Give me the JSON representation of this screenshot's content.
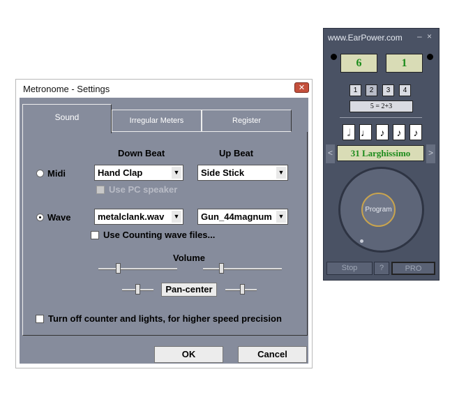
{
  "settings_dialog": {
    "title": "Metronome - Settings",
    "close_glyph": "✕",
    "tabs": [
      "Sound",
      "Irregular Meters",
      "Register"
    ],
    "columns": {
      "down_beat": "Down Beat",
      "up_beat": "Up Beat"
    },
    "midi": {
      "label": "Midi",
      "down_beat_value": "Hand Clap",
      "up_beat_value": "Side Stick",
      "pc_speaker_label": "Use PC speaker"
    },
    "wave": {
      "label": "Wave",
      "down_beat_value": "metalclank.wav",
      "up_beat_value": "Gun_44magnum",
      "counting_label": "Use Counting wave files..."
    },
    "volume_label": "Volume",
    "pan_center_label": "Pan-center",
    "turn_off_label": "Turn off counter and lights, for higher speed precision",
    "ok_label": "OK",
    "cancel_label": "Cancel"
  },
  "earpower": {
    "title": "www.EarPower.com",
    "window_controls": "– ×",
    "beats": "6",
    "count": "1",
    "group_buttons": [
      "1",
      "2",
      "3",
      "4"
    ],
    "grouping": "5 = 2+3",
    "note_values": [
      "𝅗𝅥",
      "♩",
      "♪",
      "♪",
      "♪"
    ],
    "tempo_prev": "<",
    "tempo": "31  Larghissimo",
    "tempo_next": ">",
    "program_label": "Program",
    "stop_label": "Stop",
    "help_label": "?",
    "pro_label": "PRO"
  },
  "colors": {
    "dialog_panel": "#868c9c",
    "widget_body": "#4a5264",
    "display_bg": "#d9dcb6",
    "display_text": "#1b8b1b",
    "knob_ring": "#c9a44e"
  }
}
